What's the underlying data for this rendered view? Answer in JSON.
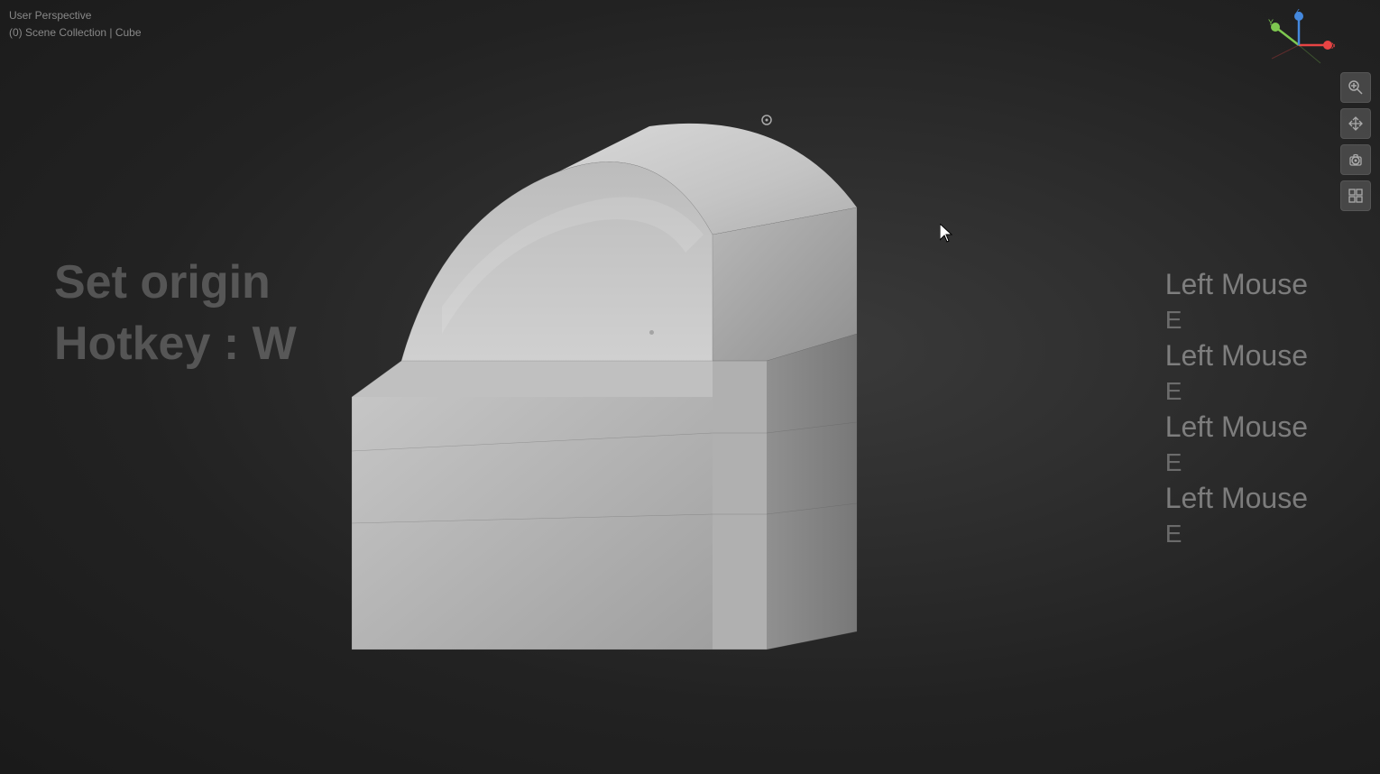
{
  "viewport": {
    "label": "User Perspective",
    "collection": "(0) Scene Collection | Cube"
  },
  "overlay_text": {
    "line1": "Set origin",
    "line2": "Hotkey : W"
  },
  "action_log": [
    {
      "action": "Left Mouse",
      "key": "E"
    },
    {
      "action": "Left Mouse",
      "key": "E"
    },
    {
      "action": "Left Mouse",
      "key": "E"
    },
    {
      "action": "Left Mouse",
      "key": "E"
    }
  ],
  "toolbar": {
    "buttons": [
      {
        "icon": "🔍",
        "name": "zoom"
      },
      {
        "icon": "✋",
        "name": "pan"
      },
      {
        "icon": "👤",
        "name": "camera"
      },
      {
        "icon": "⊞",
        "name": "grid"
      }
    ]
  },
  "axis_gizmo": {
    "x_color": "#e84444",
    "y_color": "#7ec850",
    "z_color": "#4488dd",
    "x_label": "X",
    "y_label": "Y",
    "z_label": "Z"
  }
}
